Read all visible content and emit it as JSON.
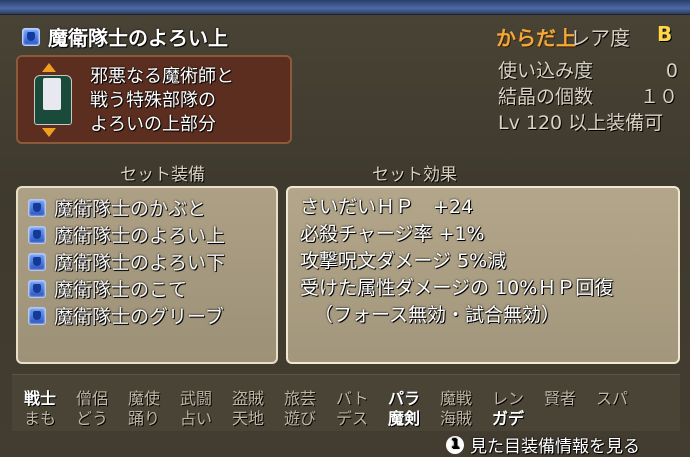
{
  "header": {
    "item_name": "魔衛隊士のよろい上",
    "category": "からだ上",
    "rarity_label": "レア度",
    "rarity_value": "B"
  },
  "description": {
    "line1": "邪悪なる魔術師と",
    "line2": "戦う特殊部隊の",
    "line3": "よろいの上部分"
  },
  "stats": {
    "usage_label": "使い込み度",
    "usage_value": "0",
    "crystal_label": "結晶の個数",
    "crystal_value": "１０",
    "level_label": "Lv 120 以上装備可"
  },
  "set": {
    "equip_header": "セット装備",
    "effect_header": "セット効果",
    "items": [
      {
        "label": "魔衛隊士のかぶと",
        "icon": "helmet-icon"
      },
      {
        "label": "魔衛隊士のよろい上",
        "icon": "body-upper-icon"
      },
      {
        "label": "魔衛隊士のよろい下",
        "icon": "body-lower-icon"
      },
      {
        "label": "魔衛隊士のこて",
        "icon": "gauntlet-icon"
      },
      {
        "label": "魔衛隊士のグリーブ",
        "icon": "greaves-icon"
      }
    ],
    "effects": [
      "さいだいＨＰ　+24",
      "必殺チャージ率 +1%",
      "攻撃呪文ダメージ 5%減",
      "受けた属性ダメージの 10%ＨＰ回復",
      "（フォース無効・試合無効）"
    ]
  },
  "jobs": {
    "row1": [
      "戦士",
      "僧侶",
      "魔使",
      "武闘",
      "盗賊",
      "旅芸",
      "バト",
      "パラ",
      "魔戦",
      "レン",
      "賢者",
      "スパ"
    ],
    "row2": [
      "まも",
      "どう",
      "踊り",
      "占い",
      "天地",
      "遊び",
      "デス",
      "魔剣",
      "海賊",
      "ガデ"
    ],
    "row1_enabled": [
      true,
      false,
      false,
      false,
      false,
      false,
      false,
      true,
      false,
      false,
      false,
      false
    ],
    "row2_enabled": [
      false,
      false,
      false,
      false,
      false,
      false,
      false,
      true,
      false,
      true
    ]
  },
  "footer": {
    "button_num": "1",
    "action_label": "見た目装備情報を見る"
  }
}
